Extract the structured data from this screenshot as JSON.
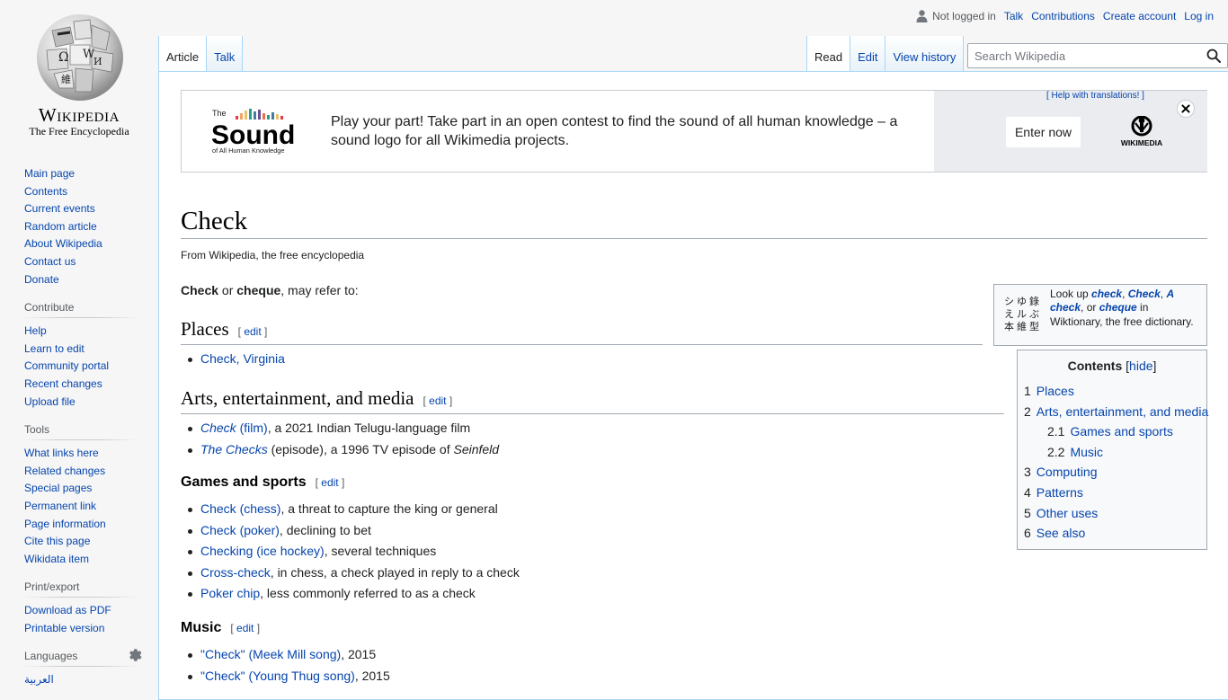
{
  "logo": {
    "wordmark": "Wikipedia",
    "tagline": "The Free Encyclopedia"
  },
  "personal": {
    "not_logged_in": "Not logged in",
    "talk": "Talk",
    "contributions": "Contributions",
    "create_account": "Create account",
    "login": "Log in"
  },
  "tabs": {
    "left": [
      "Article",
      "Talk"
    ],
    "right": [
      "Read",
      "Edit",
      "View history"
    ]
  },
  "search": {
    "placeholder": "Search Wikipedia"
  },
  "sidebar": {
    "navigation": [
      "Main page",
      "Contents",
      "Current events",
      "Random article",
      "About Wikipedia",
      "Contact us",
      "Donate"
    ],
    "contribute": {
      "heading": "Contribute",
      "items": [
        "Help",
        "Learn to edit",
        "Community portal",
        "Recent changes",
        "Upload file"
      ]
    },
    "tools": {
      "heading": "Tools",
      "items": [
        "What links here",
        "Related changes",
        "Special pages",
        "Permanent link",
        "Page information",
        "Cite this page",
        "Wikidata item"
      ]
    },
    "print": {
      "heading": "Print/export",
      "items": [
        "Download as PDF",
        "Printable version"
      ]
    },
    "languages": {
      "heading": "Languages",
      "items": [
        "العربية"
      ]
    }
  },
  "banner": {
    "logo_the": "The",
    "logo_sound": "Sound",
    "logo_sub": "of All Human Knowledge",
    "message": "Play your part! Take part in an open contest to find the sound of all human knowledge – a sound logo for all Wikimedia projects.",
    "help": "[ Help with translations! ]",
    "enter": "Enter now",
    "wikimedia": "WIKIMEDIA"
  },
  "article": {
    "title": "Check",
    "tagline": "From Wikipedia, the free encyclopedia",
    "intro": {
      "b1": "Check",
      "mid": " or ",
      "b2": "cheque",
      "end": ", may refer to:"
    },
    "edit_label": "edit",
    "sections": {
      "places": {
        "heading": "Places",
        "items": [
          {
            "link": "Check, Virginia",
            "rest": ""
          }
        ]
      },
      "arts": {
        "heading": "Arts, entertainment, and media",
        "items": [
          {
            "link_i": "Check",
            "link": " (film)",
            "rest": ", a 2021 Indian Telugu-language film"
          },
          {
            "link_i": "The Checks",
            "rest1": " (episode), a 1996 TV episode of ",
            "rest_i": "Seinfeld"
          }
        ]
      },
      "games": {
        "heading": "Games and sports",
        "items": [
          {
            "link": "Check (chess)",
            "rest": ", a threat to capture the king or general"
          },
          {
            "link": "Check (poker)",
            "rest": ", declining to bet"
          },
          {
            "link": "Checking (ice hockey)",
            "rest": ", several techniques"
          },
          {
            "link": "Cross-check",
            "rest": ", in chess, a check played in reply to a check"
          },
          {
            "link": "Poker chip",
            "rest": ", less commonly referred to as a check"
          }
        ]
      },
      "music": {
        "heading": "Music",
        "items": [
          {
            "link": "\"Check\" (Meek Mill song)",
            "rest": ", 2015"
          },
          {
            "link": "\"Check\" (Young Thug song)",
            "rest": ", 2015"
          }
        ]
      }
    }
  },
  "wiktionary": {
    "pre": "Look up ",
    "w1": "check",
    "s1": ", ",
    "w2": "Check",
    "s2": ", ",
    "w3": "A check",
    "s3": ", or ",
    "w4": "cheque",
    "post": " in Wiktionary, the free dictionary."
  },
  "toc": {
    "title": "Contents",
    "hide": "hide",
    "items": [
      {
        "num": "1",
        "label": "Places"
      },
      {
        "num": "2",
        "label": "Arts, entertainment, and media"
      },
      {
        "num": "2.1",
        "label": "Games and sports"
      },
      {
        "num": "2.2",
        "label": "Music"
      },
      {
        "num": "3",
        "label": "Computing"
      },
      {
        "num": "4",
        "label": "Patterns"
      },
      {
        "num": "5",
        "label": "Other uses"
      },
      {
        "num": "6",
        "label": "See also"
      }
    ]
  },
  "colors": {
    "link": "#0645ad",
    "tab_border": "#a7d7f9",
    "text": "#202122"
  }
}
